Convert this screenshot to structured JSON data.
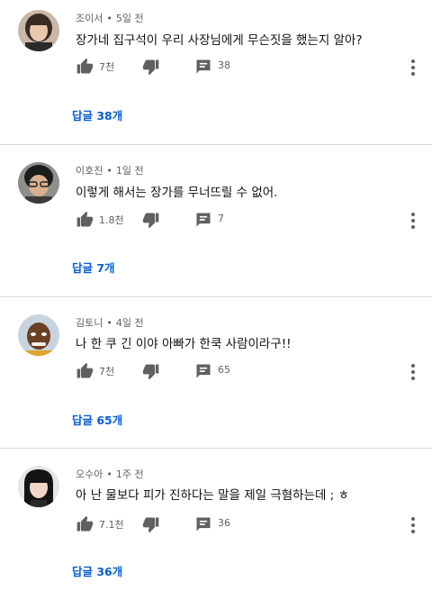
{
  "comments": [
    {
      "author": "조이서",
      "time": "5일 전",
      "text": "장가네 집구석이 우리 사장님에게 무슨짓을 했는지 알아?",
      "likes": "7천",
      "replies_count": "38",
      "replies_label": "답글 38개"
    },
    {
      "author": "이호진",
      "time": "1일 전",
      "text": "이렇게 해서는 장가를 무너뜨릴 수 없어.",
      "likes": "1.8천",
      "replies_count": "7",
      "replies_label": "답글 7개"
    },
    {
      "author": "김토니",
      "time": "4일 전",
      "text": "나 한 쿠 긴 이야 아빠가 한쿡 사람이라구!!",
      "likes": "7천",
      "replies_count": "65",
      "replies_label": "답글 65개"
    },
    {
      "author": "오수아",
      "time": "1주 전",
      "text": "아 난 물보다 피가 진하다는 말을 제일 극혐하는데 ; ㅎ",
      "likes": "7.1천",
      "replies_count": "36",
      "replies_label": "답글 36개"
    }
  ],
  "separator": "•",
  "colors": {
    "link": "#065fd4",
    "secondary_text": "#606060",
    "icon": "#606060",
    "divider": "#d9d9d9"
  },
  "icons": {
    "like": "thumbs-up-icon",
    "dislike": "thumbs-down-icon",
    "reply": "comment-icon",
    "more": "more-vertical-icon"
  }
}
